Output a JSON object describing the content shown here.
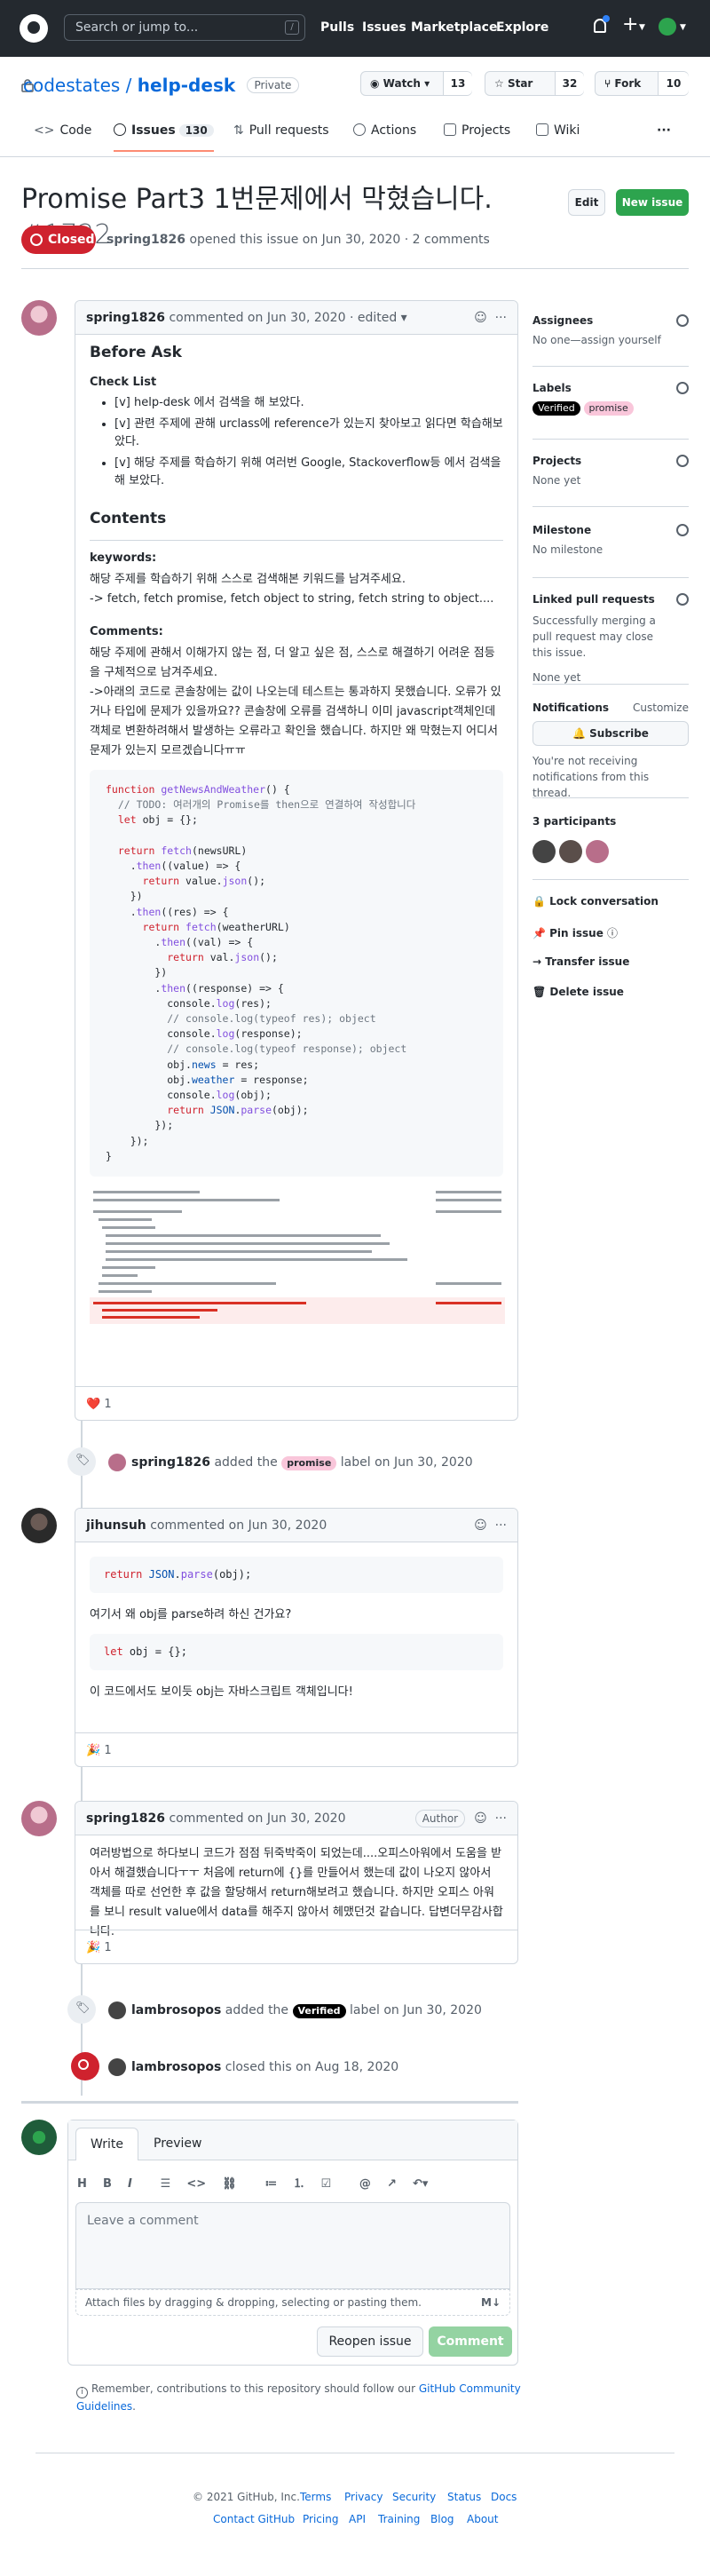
{
  "header": {
    "search_placeholder": "Search or jump to...",
    "slash": "/",
    "nav": [
      "Pulls",
      "Issues",
      "Marketplace",
      "Explore"
    ],
    "plus": "+"
  },
  "repo": {
    "owner": "codestates",
    "name": "help-desk",
    "visibility": "Private",
    "watch_label": "Watch",
    "watch_count": "13",
    "star_label": "Star",
    "star_count": "32",
    "fork_label": "Fork",
    "fork_count": "10",
    "tabs": [
      {
        "label": "Code"
      },
      {
        "label": "Issues",
        "count": "130"
      },
      {
        "label": "Pull requests"
      },
      {
        "label": "Actions"
      },
      {
        "label": "Projects"
      },
      {
        "label": "Wiki"
      }
    ],
    "more": "···"
  },
  "issue": {
    "title": "Promise Part3 1번문제에서 막혔습니다.",
    "number": "#1722",
    "edit_label": "Edit",
    "new_label": "New issue",
    "state": "Closed",
    "author": "spring1826",
    "meta_text": " opened this issue on Jun 30, 2020 · 2 comments"
  },
  "comments": [
    {
      "author": "spring1826",
      "meta": " commented on Jun 30, 2020 · edited ▾",
      "h_before": "Before Ask",
      "h_checklist": "Check List",
      "checklist": [
        "[v] help-desk 에서 검색을 해 보았다.",
        "[v] 관련 주제에 관해 urclass에 reference가 있는지 찾아보고 읽다면 학습해보았다.",
        "[v] 해당 주제를 학습하기 위해 여러번 Google, Stackoverflow등 에서 검색을 해 보았다."
      ],
      "h_contents": "Contents",
      "h_keywords": "keywords:",
      "keywords_text": "해당 주제를 학습하기 위해 스스로 검색해본 키워드를 남겨주세요.",
      "keywords_list": "-> fetch, fetch promise, fetch object to string, fetch string to object....",
      "h_comments": "Comments:",
      "comments_text": "해당 주제에 관해서 이해가지 않는 점, 더 알고 싶은 점, 스스로 해결하기 어려운 점등을 구체적으로 남겨주세요.",
      "comments_text2": "->아래의 코드로 콘솔창에는 값이 나오는데 테스트는 통과하지 못했습니다. 오류가 있거나 타입에 문제가 있을까요?? 콘솔창에 오류를 검색하니 이미 javascript객체인데 객체로 변환하려해서 발생하는 오류라고 확인을 했습니다. 하지만 왜 막혔는지 어디서 문제가 있는지 모르겠습니다ㅠㅠ",
      "reaction": "1"
    },
    {
      "author": "jihunsuh",
      "meta": " commented on Jun 30, 2020",
      "code1": "return JSON.parse(obj);",
      "text1": "여기서 왜 obj를 parse하려 하신 건가요?",
      "code2": "let obj = {};",
      "text2": "이 코드에서도 보이듯 obj는 자바스크립트 객체입니다!",
      "reaction": "1"
    },
    {
      "author": "spring1826",
      "meta": " commented on Jun 30, 2020",
      "author_badge": "Author",
      "text": "여러방법으로 하다보니 코드가 점점 뒤죽박죽이 되었는데....오피스아워에서 도움을 받아서 해결했습니다ㅜㅜ 처음에 return에 {}를 만들어서 했는데 값이 나오지 않아서 객체를 따로 선언한 후 값을 할당해서 return해보려고 했습니다. 하지만 오피스 아워를 보니 result value에서 data를 해주지 않아서 헤맸던것 같습니다. 답변더무감사합니다.",
      "reaction": "1"
    }
  ],
  "events": [
    {
      "actor": "spring1826",
      "pre": " added the ",
      "label": "promise",
      "post": " label on Jun 30, 2020"
    },
    {
      "actor": "lambrosopos",
      "pre": " added the ",
      "label": "Verified",
      "post": " label on Jun 30, 2020"
    },
    {
      "actor": "lambrosopos",
      "pre": " closed this on Aug 18, 2020",
      "label": "",
      "post": ""
    }
  ],
  "sidebar": {
    "assignees_h": "Assignees",
    "assignees_v": "No one—assign yourself",
    "labels_h": "Labels",
    "labels": [
      "Verified",
      "promise"
    ],
    "projects_h": "Projects",
    "projects_v": "None yet",
    "milestone_h": "Milestone",
    "milestone_v": "No milestone",
    "linked_h": "Linked pull requests",
    "linked_v": "Successfully merging a pull request may close this issue.",
    "linked_none": "None yet",
    "notif_h": "Notifications",
    "notif_customize": "Customize",
    "subscribe": "Subscribe",
    "notif_v": "You're not receiving notifications from this thread.",
    "participants_h": "3 participants",
    "actions": [
      "Lock conversation",
      "Pin issue",
      "Transfer issue",
      "Delete issue"
    ]
  },
  "composer": {
    "tab_write": "Write",
    "tab_preview": "Preview",
    "placeholder": "Leave a comment",
    "attach": "Attach files by dragging & dropping, selecting or pasting them.",
    "reopen": "Reopen issue",
    "comment": "Comment",
    "tip_pre": "Remember, contributions to this repository should follow our ",
    "tip_link": "GitHub Community Guidelines",
    "tip_post": "."
  },
  "footer": {
    "copyright": "© 2021 GitHub, Inc.",
    "row1": [
      "Terms",
      "Privacy",
      "Security",
      "Status",
      "Docs"
    ],
    "row2": [
      "Contact GitHub",
      "Pricing",
      "API",
      "Training",
      "Blog",
      "About"
    ]
  },
  "colors": {
    "closed": "#cf222e",
    "new_issue": "#2da44e",
    "verified_label": "#000000",
    "promise_label": "#f9c6da"
  }
}
